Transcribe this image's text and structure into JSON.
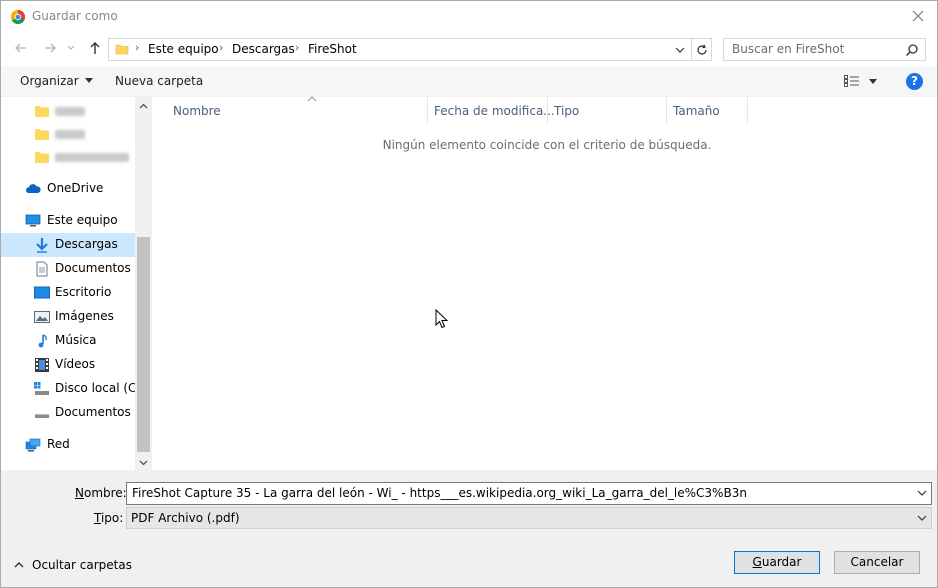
{
  "window": {
    "title": "Guardar como"
  },
  "address": {
    "crumbs": [
      "Este equipo",
      "Descargas",
      "FireShot"
    ],
    "separator": "›"
  },
  "search": {
    "placeholder": "Buscar en FireShot"
  },
  "toolbar": {
    "organize_label": "Organizar",
    "new_folder_label": "Nueva carpeta",
    "help_label": "?"
  },
  "sidebar": {
    "items": [
      {
        "label": "OneDrive",
        "icon": "cloud-icon"
      },
      {
        "label": "Este equipo",
        "icon": "computer-icon"
      },
      {
        "label": "Descargas",
        "icon": "download-arrow-icon",
        "selected": true
      },
      {
        "label": "Documentos",
        "icon": "documents-icon"
      },
      {
        "label": "Escritorio",
        "icon": "desktop-icon"
      },
      {
        "label": "Imágenes",
        "icon": "pictures-icon"
      },
      {
        "label": "Música",
        "icon": "music-icon"
      },
      {
        "label": "Vídeos",
        "icon": "videos-icon"
      },
      {
        "label": "Disco local (C:)",
        "icon": "drive-icon"
      },
      {
        "label": "Documentos (D",
        "icon": "drive-icon"
      },
      {
        "label": "Red",
        "icon": "network-icon"
      }
    ]
  },
  "filelist": {
    "columns": [
      "Nombre",
      "Fecha de modifica...",
      "Tipo",
      "Tamaño"
    ],
    "empty_message": "Ningún elemento coincide con el criterio de búsqueda."
  },
  "form": {
    "filename_label_prefix": "",
    "filename_label_accel": "N",
    "filename_label_rest": "ombre:",
    "filename_value": "FireShot Capture 35 - La garra del león - Wi_ - https___es.wikipedia.org_wiki_La_garra_del_le%C3%B3n",
    "type_label_accel": "T",
    "type_label_rest": "ipo:",
    "type_value": "PDF Archivo (.pdf)"
  },
  "footer": {
    "hide_folders_label": "Ocultar carpetas",
    "save_label_accel": "G",
    "save_label_rest": "uardar",
    "cancel_label": "Cancelar"
  },
  "colors": {
    "selected_bg": "#cce8ff",
    "accent": "#0078d7",
    "help_blue": "#1a73e8"
  }
}
